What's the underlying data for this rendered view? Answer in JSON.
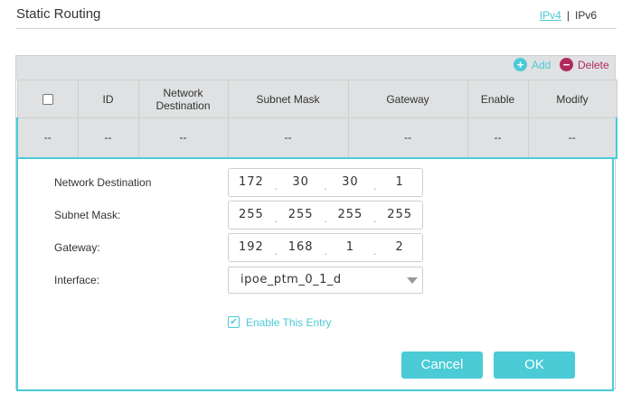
{
  "header": {
    "title": "Static Routing",
    "ipv4_label": "IPv4",
    "separator": "|",
    "ipv6_label": "IPv6"
  },
  "toolbar": {
    "add_label": "Add",
    "delete_label": "Delete",
    "add_icon": "plus-circle-icon",
    "delete_icon": "minus-circle-icon"
  },
  "table": {
    "columns": [
      "",
      "ID",
      "Network Destination",
      "Subnet Mask",
      "Gateway",
      "Enable",
      "Modify"
    ],
    "rows": [
      [
        "--",
        "--",
        "--",
        "--",
        "--",
        "--",
        "--"
      ]
    ]
  },
  "form": {
    "network_destination": {
      "label": "Network Destination",
      "octets": [
        "172",
        "30",
        "30",
        "1"
      ]
    },
    "subnet_mask": {
      "label": "Subnet Mask:",
      "octets": [
        "255",
        "255",
        "255",
        "255"
      ]
    },
    "gateway": {
      "label": "Gateway:",
      "octets": [
        "192",
        "168",
        "1",
        "2"
      ]
    },
    "interface": {
      "label": "Interface:",
      "value": "ipoe_ptm_0_1_d"
    },
    "enable_entry": {
      "label": "Enable This Entry",
      "checked": true
    },
    "cancel_label": "Cancel",
    "ok_label": "OK"
  },
  "colors": {
    "accent": "#4acbd6",
    "delete": "#b02a5b",
    "header_bg": "#dfe1e2"
  }
}
